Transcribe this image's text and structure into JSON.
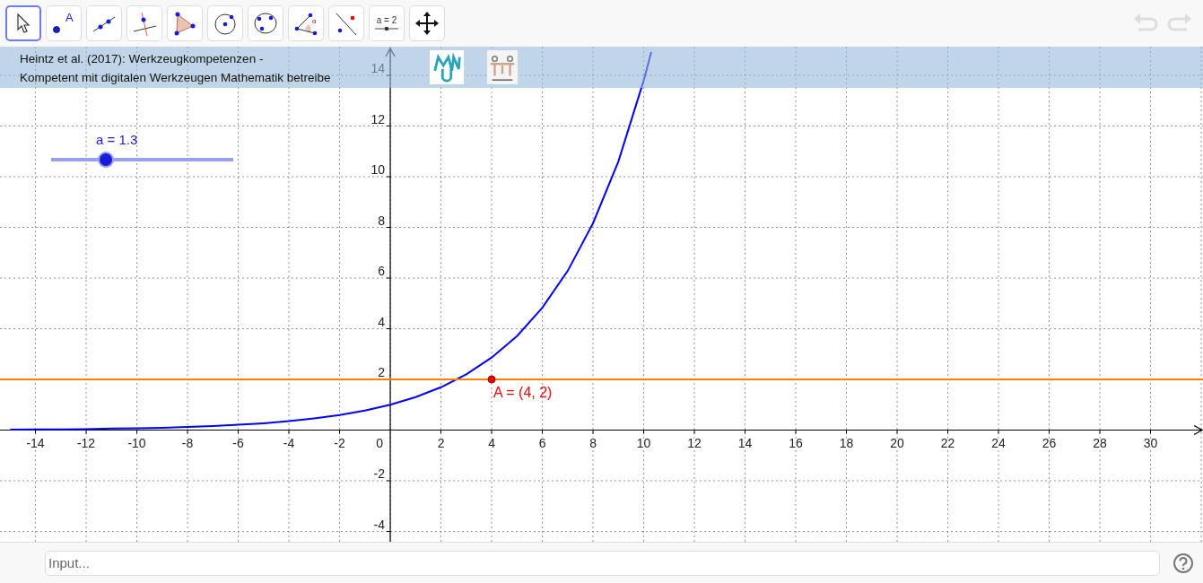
{
  "toolbar": {
    "tools": [
      {
        "kind": "move",
        "selected": true
      },
      {
        "kind": "point",
        "selected": false,
        "label": "A"
      },
      {
        "kind": "line",
        "selected": false
      },
      {
        "kind": "perpendicular",
        "selected": false
      },
      {
        "kind": "polygon",
        "selected": false
      },
      {
        "kind": "circle",
        "selected": false
      },
      {
        "kind": "circle3",
        "selected": false
      },
      {
        "kind": "angle",
        "selected": false,
        "label": "α"
      },
      {
        "kind": "reflect",
        "selected": false
      },
      {
        "kind": "slider",
        "selected": false,
        "label": "a = 2"
      },
      {
        "kind": "pan",
        "selected": false
      }
    ],
    "undo": {
      "disabled": true
    },
    "redo": {
      "disabled": true
    }
  },
  "banner": {
    "lines": [
      "Heintz et al. (2017): Werkzeugkompetenzen -",
      "Kompetent mit digitalen Werkzeugen Mathematik betreibe"
    ]
  },
  "slider": {
    "label": "a = 1.3",
    "level": 0.3
  },
  "graph": {
    "chart_data": {
      "type": "line",
      "x": [
        -15,
        -14,
        -13,
        -12,
        -11,
        -10,
        -9,
        -8,
        -7,
        -6,
        -5,
        -4,
        -3,
        -2,
        -1,
        0,
        1,
        2,
        3,
        4,
        5,
        6,
        7,
        8,
        9,
        10,
        10.3
      ],
      "series": [
        {
          "color": "#0000ff",
          "values": [
            0.02,
            0.03,
            0.03,
            0.04,
            0.06,
            0.07,
            0.09,
            0.12,
            0.16,
            0.21,
            0.27,
            0.35,
            0.46,
            0.59,
            0.77,
            1,
            1.3,
            1.69,
            2.2,
            2.86,
            3.71,
            4.83,
            6.28,
            8.16,
            10.6,
            13.79,
            14.92
          ]
        }
      ],
      "ref_lines": [
        {
          "axis": "y",
          "value": 2,
          "color": "#ff7f00"
        }
      ],
      "grid": true,
      "xlim": [
        -15.4,
        32.07
      ],
      "ylim": [
        -4.407,
        15.133
      ],
      "xticks": [
        -14,
        -12,
        -10,
        -8,
        -6,
        -4,
        -2,
        2,
        4,
        6,
        8,
        10,
        12,
        14,
        16,
        18,
        20,
        22,
        24,
        26,
        28,
        30
      ],
      "yticks": [
        -4,
        -2,
        2,
        4,
        6,
        8,
        10,
        12,
        14
      ],
      "annotations": [
        {
          "text": "A = (4, 2)",
          "x": 4,
          "y": 2
        }
      ]
    },
    "origin_label": "0"
  },
  "input_bar": {
    "placeholder": "Input..."
  }
}
